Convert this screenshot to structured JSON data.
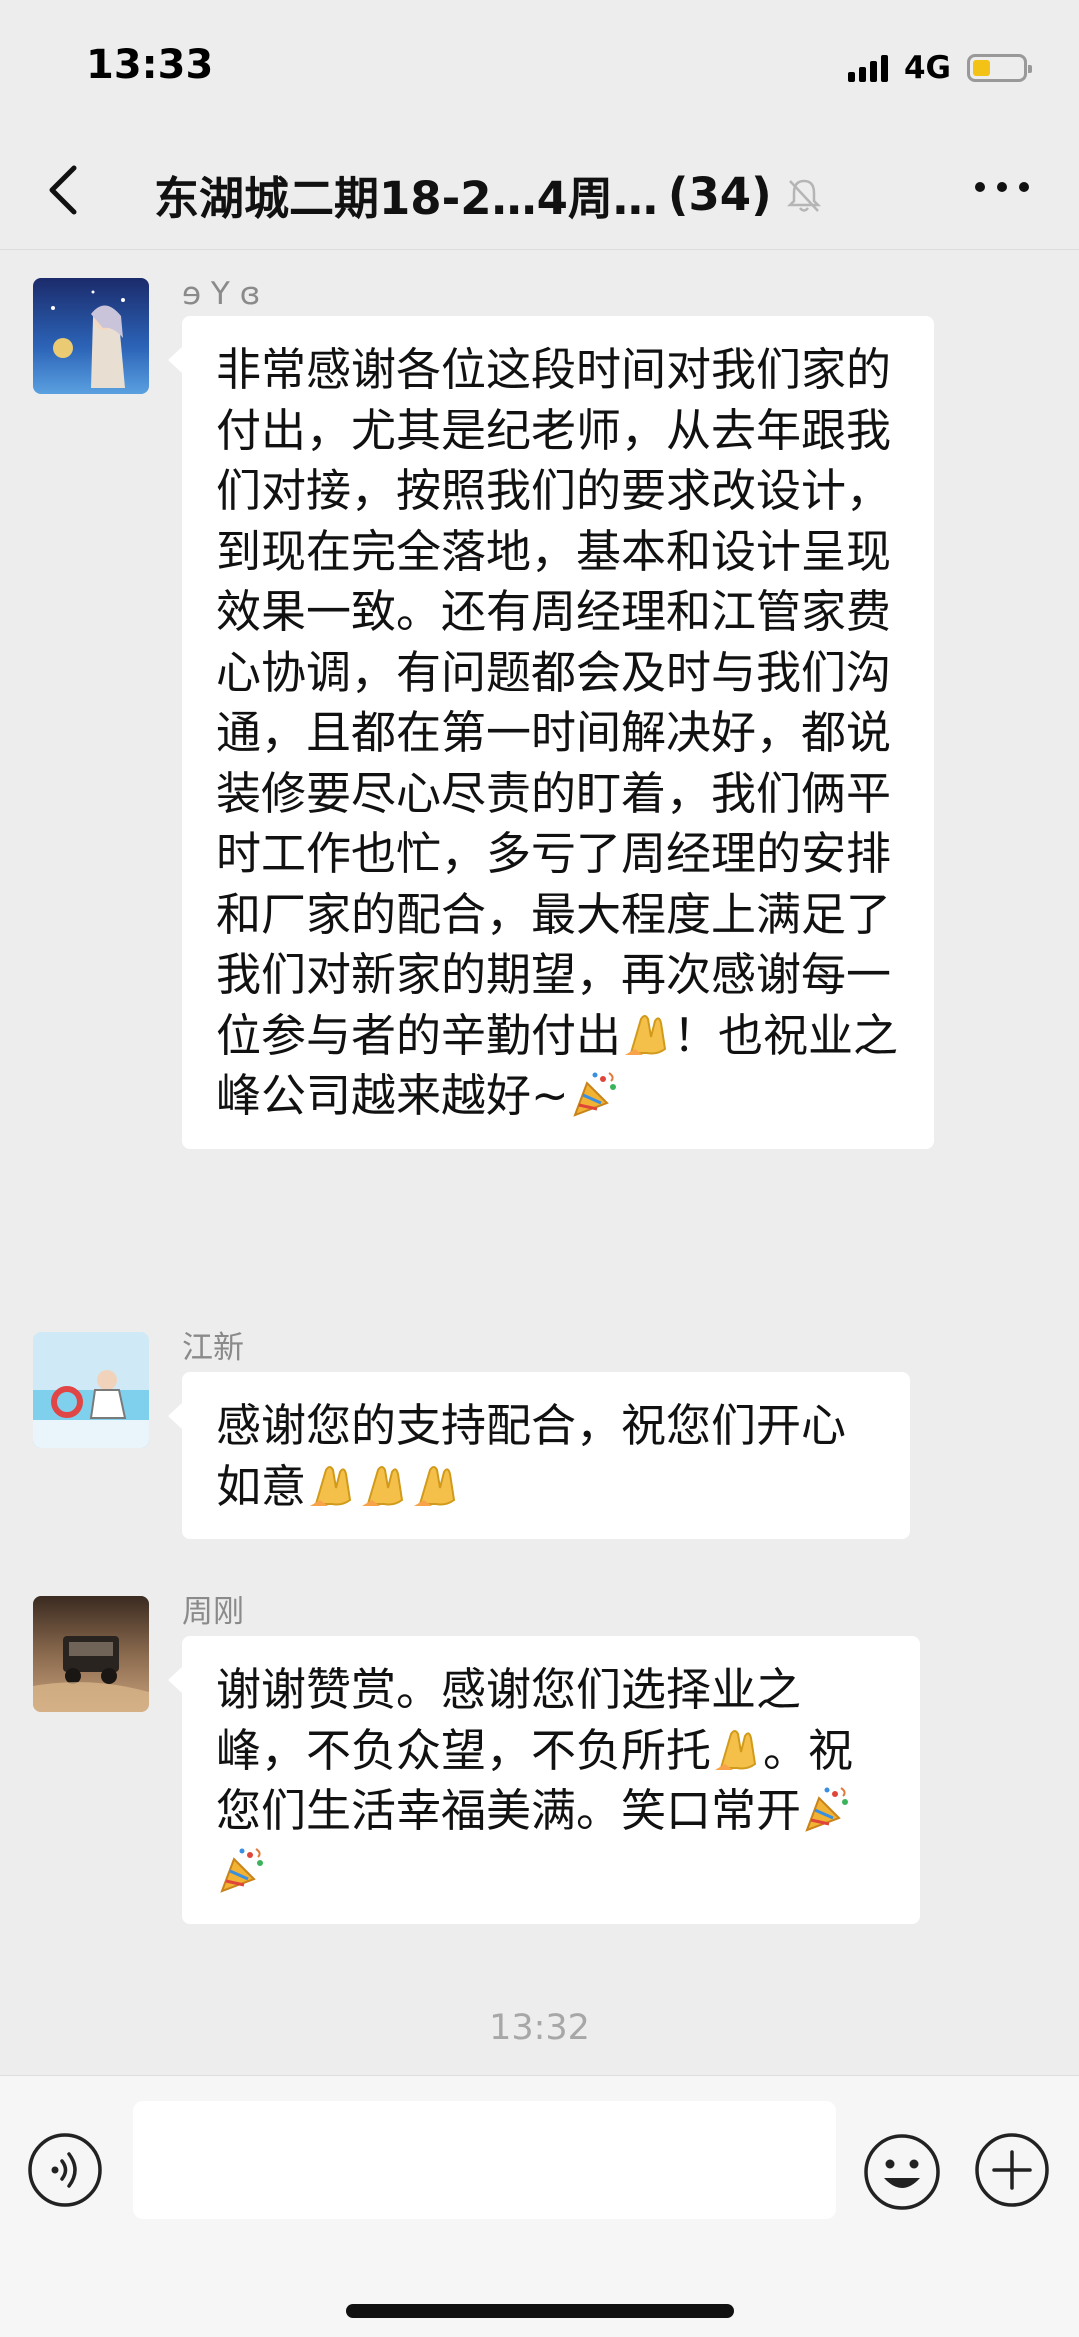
{
  "status_bar": {
    "time": "13:33",
    "network": "4G",
    "battery_level": 0.35
  },
  "nav": {
    "title": "东湖城二期18-2…4周…",
    "member_count": "(34)",
    "icons": [
      "back-icon",
      "mute-bell-icon",
      "more-icon"
    ]
  },
  "messages": [
    {
      "sender": "ɘ Y ɞ",
      "text": "非常感谢各位这段时间对我们家的付出，尤其是纪老师，从去年跟我们对接，按照我们的要求改设计，到现在完全落地，基本和设计呈现效果一致。还有周经理和江管家费心协调，有问题都会及时与我们沟通，且都在第一时间解决好，都说装修要尽心尽责的盯着，我们俩平时工作也忙，多亏了周经理的安排和厂家的配合，最大程度上满足了我们对新家的期望，再次感谢每一位参与者的辛勤付出",
      "text_after_emoji": "！也祝业之峰公司越来越好~",
      "emojis": [
        "praying-hands-emoji",
        "party-popper-emoji"
      ]
    },
    {
      "sender": "江新",
      "text": "感谢您的支持配合，祝您们开心如意",
      "emojis": [
        "praying-hands-emoji",
        "praying-hands-emoji",
        "praying-hands-emoji"
      ]
    },
    {
      "sender": "周刚",
      "text": "谢谢赞赏。感谢您们选择业之峰，不负众望，不负所托",
      "text_after_emoji": "。祝您们生活幸福美满。笑口常开",
      "emojis": [
        "praying-hands-emoji",
        "party-popper-emoji",
        "party-popper-emoji"
      ]
    }
  ],
  "timestamp": "13:32",
  "input_bar": {
    "placeholder": "",
    "icons": [
      "voice-icon",
      "emoji-icon",
      "plus-icon"
    ]
  },
  "colors": {
    "background": "#ededed",
    "bubble": "#ffffff",
    "sender_name": "#8a8a8a",
    "battery": "#f2c316"
  }
}
